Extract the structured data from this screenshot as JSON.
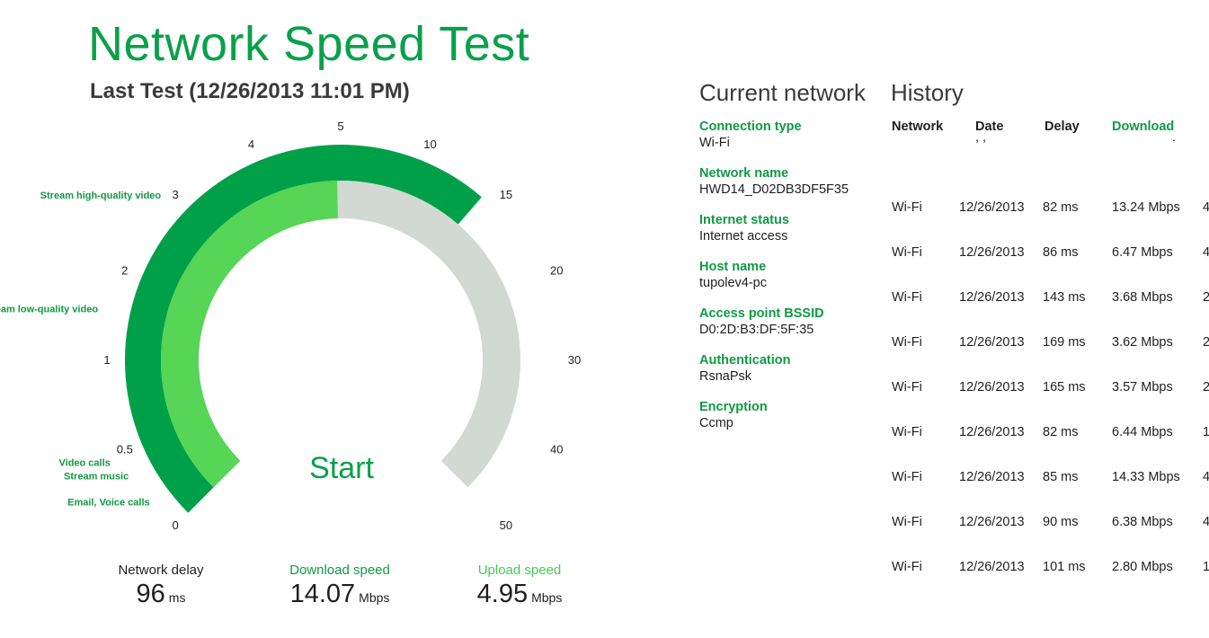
{
  "app": {
    "title": "Network Speed Test",
    "last_test": "Last Test (12/26/2013 11:01 PM)"
  },
  "gauge": {
    "ticks": [
      "0",
      "0.5",
      "1",
      "2",
      "3",
      "4",
      "5",
      "10",
      "15",
      "20",
      "30",
      "40",
      "50"
    ],
    "use_labels": [
      "Email, Voice calls",
      "Stream music",
      "Video calls",
      "Stream low-quality video",
      "Stream high-quality video"
    ],
    "start_label": "Start",
    "download_mbps": 14.07,
    "upload_mbps": 4.95,
    "colors": {
      "download": "#00a049",
      "upload": "#56d556",
      "track": "#d1d9d2"
    }
  },
  "metrics": {
    "delay": {
      "label": "Network delay",
      "value": "96",
      "unit": "ms"
    },
    "download": {
      "label": "Download speed",
      "value": "14.07",
      "unit": "Mbps"
    },
    "upload": {
      "label": "Upload speed",
      "value": "4.95",
      "unit": "Mbps"
    }
  },
  "current_network": {
    "heading": "Current network",
    "items": [
      {
        "key": "Connection type",
        "value": "Wi-Fi"
      },
      {
        "key": "Network name",
        "value": "HWD14_D02DB3DF5F35"
      },
      {
        "key": "Internet status",
        "value": "Internet access"
      },
      {
        "key": "Host name",
        "value": "tupolev4-pc"
      },
      {
        "key": "Access point BSSID",
        "value": "D0:2D:B3:DF:5F:35"
      },
      {
        "key": "Authentication",
        "value": "RsnaPsk"
      },
      {
        "key": "Encryption",
        "value": "Ccmp"
      }
    ]
  },
  "history": {
    "heading": "History",
    "columns": {
      "network": "Network",
      "date": "Date",
      "delay": "Delay",
      "download": "Download"
    },
    "rows": [
      {
        "network": "Wi-Fi",
        "date": "12/26/2013",
        "delay": "82 ms",
        "download": "13.24 Mbps",
        "upload": "4"
      },
      {
        "network": "Wi-Fi",
        "date": "12/26/2013",
        "delay": "86 ms",
        "download": "6.47 Mbps",
        "upload": "4"
      },
      {
        "network": "Wi-Fi",
        "date": "12/26/2013",
        "delay": "143 ms",
        "download": "3.68 Mbps",
        "upload": "2"
      },
      {
        "network": "Wi-Fi",
        "date": "12/26/2013",
        "delay": "169 ms",
        "download": "3.62 Mbps",
        "upload": "2"
      },
      {
        "network": "Wi-Fi",
        "date": "12/26/2013",
        "delay": "165 ms",
        "download": "3.57 Mbps",
        "upload": "2"
      },
      {
        "network": "Wi-Fi",
        "date": "12/26/2013",
        "delay": "82 ms",
        "download": "6.44 Mbps",
        "upload": "1"
      },
      {
        "network": "Wi-Fi",
        "date": "12/26/2013",
        "delay": "85 ms",
        "download": "14.33 Mbps",
        "upload": "4"
      },
      {
        "network": "Wi-Fi",
        "date": "12/26/2013",
        "delay": "90 ms",
        "download": "6.38 Mbps",
        "upload": "4"
      },
      {
        "network": "Wi-Fi",
        "date": "12/26/2013",
        "delay": "101 ms",
        "download": "2.80 Mbps",
        "upload": "1"
      }
    ]
  }
}
